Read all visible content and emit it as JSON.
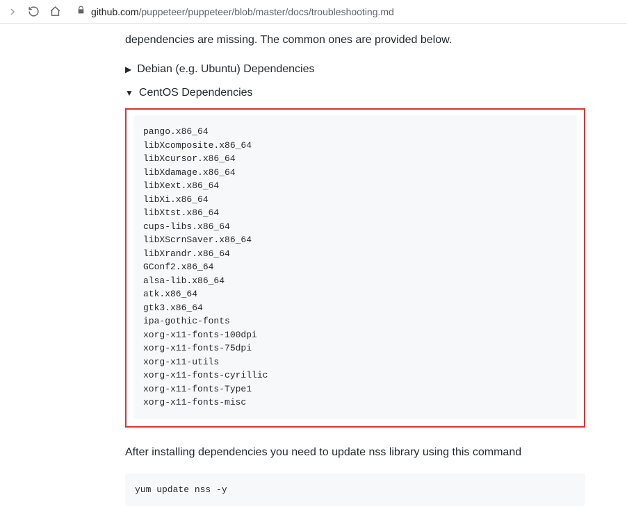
{
  "browser": {
    "url_host": "github.com",
    "url_path": "/puppeteer/puppeteer/blob/master/docs/troubleshooting.md"
  },
  "doc": {
    "lead": "dependencies are missing. The common ones are provided below.",
    "collapsed_label": "Debian (e.g. Ubuntu) Dependencies",
    "expanded_label": "CentOS Dependencies",
    "centos_packages": "pango.x86_64\nlibXcomposite.x86_64\nlibXcursor.x86_64\nlibXdamage.x86_64\nlibXext.x86_64\nlibXi.x86_64\nlibXtst.x86_64\ncups-libs.x86_64\nlibXScrnSaver.x86_64\nlibXrandr.x86_64\nGConf2.x86_64\nalsa-lib.x86_64\natk.x86_64\ngtk3.x86_64\nipa-gothic-fonts\nxorg-x11-fonts-100dpi\nxorg-x11-fonts-75dpi\nxorg-x11-utils\nxorg-x11-fonts-cyrillic\nxorg-x11-fonts-Type1\nxorg-x11-fonts-misc",
    "after_text": "After installing dependencies you need to update nss library using this command",
    "yum_cmd": "yum update nss -y"
  }
}
